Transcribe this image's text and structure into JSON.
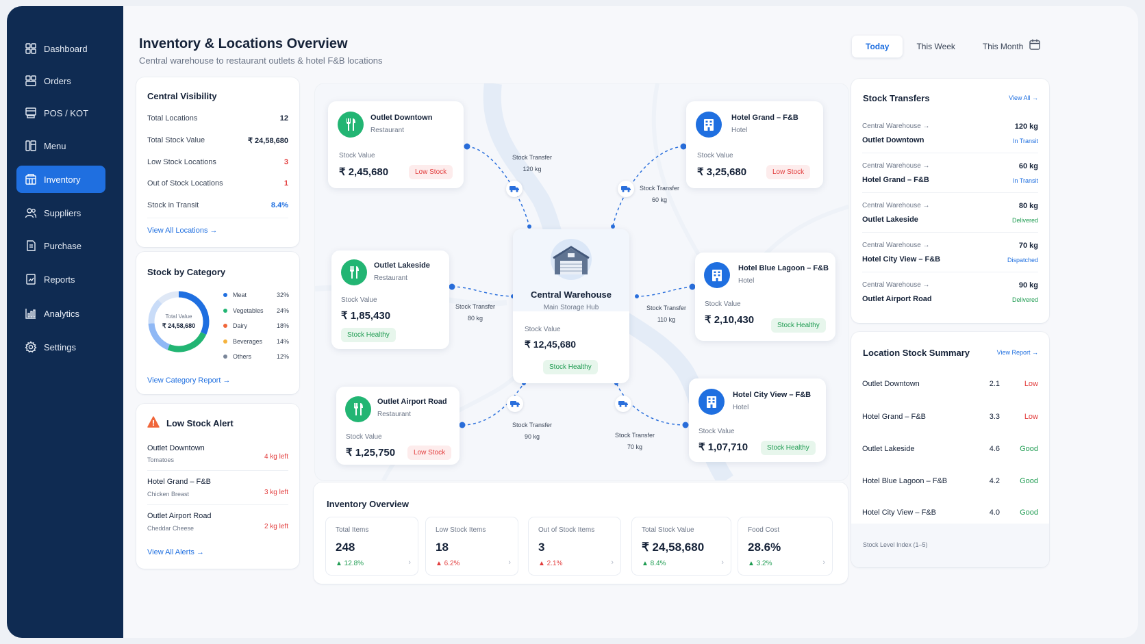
{
  "nav": [
    {
      "label": "Dashboard",
      "icon": "grid-icon"
    },
    {
      "label": "Orders",
      "icon": "orders-icon"
    },
    {
      "label": "POS / KOT",
      "icon": "pos-icon"
    },
    {
      "label": "Menu",
      "icon": "menu-icon"
    },
    {
      "label": "Inventory",
      "icon": "inventory-icon",
      "active": true
    },
    {
      "label": "Suppliers",
      "icon": "suppliers-icon"
    },
    {
      "label": "Purchase",
      "icon": "purchase-icon"
    },
    {
      "label": "Reports",
      "icon": "reports-icon"
    },
    {
      "label": "Analytics",
      "icon": "analytics-icon"
    },
    {
      "label": "Settings",
      "icon": "gear-icon"
    }
  ],
  "header": {
    "title": "Inventory & Locations Overview",
    "subtitle": "Central warehouse to restaurant outlets & hotel F&B locations",
    "ranges": [
      "Today",
      "This Week",
      "This Month"
    ],
    "active_range": "Today"
  },
  "visibility": {
    "title": "Central Visibility",
    "rows": [
      {
        "label": "Total Locations",
        "value": "12",
        "color": "#152238"
      },
      {
        "label": "Total Stock Value",
        "value": "₹ 24,58,680",
        "color": "#152238"
      },
      {
        "label": "Low Stock Locations",
        "value": "3",
        "color": "#e23b3b"
      },
      {
        "label": "Out of Stock Locations",
        "value": "1",
        "color": "#e23b3b"
      },
      {
        "label": "Stock in Transit",
        "value": "8.4%",
        "color": "#1f6fe0"
      }
    ],
    "link": "View All Locations  →"
  },
  "category": {
    "title": "Stock by Category",
    "center_label": "Total Value",
    "center_value": "₹ 24,58,680",
    "items": [
      {
        "name": "Meat",
        "pct": "32%",
        "share": 0.32,
        "color": "#1f6fe0"
      },
      {
        "name": "Vegetables",
        "pct": "24%",
        "share": 0.24,
        "color": "#22b573"
      },
      {
        "name": "Dairy",
        "pct": "18%",
        "share": 0.18,
        "color": "#8fb8f5"
      },
      {
        "name": "Beverages",
        "pct": "14%",
        "share": 0.14,
        "color": "#c9dcf8"
      },
      {
        "name": "Others",
        "pct": "12%",
        "share": 0.12,
        "color": "#dfe8f6"
      }
    ],
    "legend_colors": [
      "#1f6fe0",
      "#22b573",
      "#f0663a",
      "#f5b33d",
      "#7a8699"
    ],
    "link": "View Category Report  →"
  },
  "alerts": {
    "title": "Low Stock Alert",
    "items": [
      {
        "location": "Outlet Downtown",
        "item": "Tomatoes",
        "qty": "4 kg left"
      },
      {
        "location": "Hotel Grand – F&B",
        "item": "Chicken Breast",
        "qty": "3 kg left"
      },
      {
        "location": "Outlet Airport Road",
        "item": "Cheddar Cheese",
        "qty": "2 kg left"
      }
    ],
    "link": "View All Alerts  →"
  },
  "map": {
    "hub": {
      "name": "Central Warehouse",
      "type": "Main Storage Hub",
      "value_label": "Stock Value",
      "value": "₹ 12,45,680",
      "status": "Stock Healthy"
    },
    "nodes": [
      {
        "name": "Outlet Downtown",
        "type": "Restaurant",
        "value_label": "Stock Value",
        "value": "₹ 2,45,680",
        "status": "Low Stock",
        "kind": "restaurant"
      },
      {
        "name": "Hotel Grand – F&B",
        "type": "Hotel",
        "value_label": "Stock Value",
        "value": "₹ 3,25,680",
        "status": "Low Stock",
        "kind": "hotel"
      },
      {
        "name": "Outlet Lakeside",
        "type": "Restaurant",
        "value_label": "Stock Value",
        "value": "₹ 1,85,430",
        "status": "Stock Healthy",
        "kind": "restaurant"
      },
      {
        "name": "Hotel Blue Lagoon – F&B",
        "type": "Hotel",
        "value_label": "Stock Value",
        "value": "₹ 2,10,430",
        "status": "Stock Healthy",
        "kind": "hotel"
      },
      {
        "name": "Outlet Airport Road",
        "type": "Restaurant",
        "value_label": "Stock Value",
        "value": "₹ 1,25,750",
        "status": "Low Stock",
        "kind": "restaurant"
      },
      {
        "name": "Hotel City View – F&B",
        "type": "Hotel",
        "value_label": "Stock Value",
        "value": "₹ 1,07,710",
        "status": "Stock Healthy",
        "kind": "hotel"
      }
    ],
    "transfers": [
      {
        "label": "Stock Transfer",
        "qty": "120 kg"
      },
      {
        "label": "Stock Transfer",
        "qty": "60 kg"
      },
      {
        "label": "Stock Transfer",
        "qty": "80 kg"
      },
      {
        "label": "Stock Transfer",
        "qty": "110 kg"
      },
      {
        "label": "Stock Transfer",
        "qty": "90 kg"
      },
      {
        "label": "Stock Transfer",
        "qty": "70 kg"
      }
    ]
  },
  "overview": {
    "title": "Inventory Overview",
    "kpis": [
      {
        "label": "Total Items",
        "value": "248",
        "delta": "▲ 12.8%",
        "color": "#1d9b50"
      },
      {
        "label": "Low Stock Items",
        "value": "18",
        "delta": "▲ 6.2%",
        "color": "#e23b3b"
      },
      {
        "label": "Out of Stock Items",
        "value": "3",
        "delta": "▲ 2.1%",
        "color": "#e23b3b"
      },
      {
        "label": "Total Stock Value",
        "value": "₹ 24,58,680",
        "delta": "▲ 8.4%",
        "color": "#1d9b50"
      },
      {
        "label": "Food Cost",
        "value": "28.6%",
        "delta": "▲ 3.2%",
        "color": "#1d9b50"
      }
    ]
  },
  "transfers": {
    "title": "Stock Transfers",
    "link": "View All  →",
    "items": [
      {
        "from": "Central Warehouse  →",
        "to": "Outlet Downtown",
        "qty": "120 kg",
        "status": "In Transit",
        "color": "#1f6fe0"
      },
      {
        "from": "Central Warehouse  →",
        "to": "Hotel Grand – F&B",
        "qty": "60 kg",
        "status": "In Transit",
        "color": "#1f6fe0"
      },
      {
        "from": "Central Warehouse  →",
        "to": "Outlet Lakeside",
        "qty": "80 kg",
        "status": "Delivered",
        "color": "#1d9b50"
      },
      {
        "from": "Central Warehouse  →",
        "to": "Hotel City View – F&B",
        "qty": "70 kg",
        "status": "Dispatched",
        "color": "#1f6fe0"
      },
      {
        "from": "Central Warehouse  →",
        "to": "Outlet Airport Road",
        "qty": "90 kg",
        "status": "Delivered",
        "color": "#1d9b50"
      }
    ]
  },
  "summary": {
    "title": "Location Stock Summary",
    "link": "View Report  →",
    "rows": [
      {
        "name": "Outlet Downtown",
        "score": "2.1",
        "grade": "Low",
        "color": "#e23b3b"
      },
      {
        "name": "Hotel Grand – F&B",
        "score": "3.3",
        "grade": "Low",
        "color": "#e23b3b"
      },
      {
        "name": "Outlet Lakeside",
        "score": "4.6",
        "grade": "Good",
        "color": "#1d9b50"
      },
      {
        "name": "Hotel Blue Lagoon – F&B",
        "score": "4.2",
        "grade": "Good",
        "color": "#1d9b50"
      },
      {
        "name": "Hotel City View – F&B",
        "score": "4.0",
        "grade": "Good",
        "color": "#1d9b50"
      }
    ],
    "footnote": "Stock Level Index (1–5)"
  }
}
